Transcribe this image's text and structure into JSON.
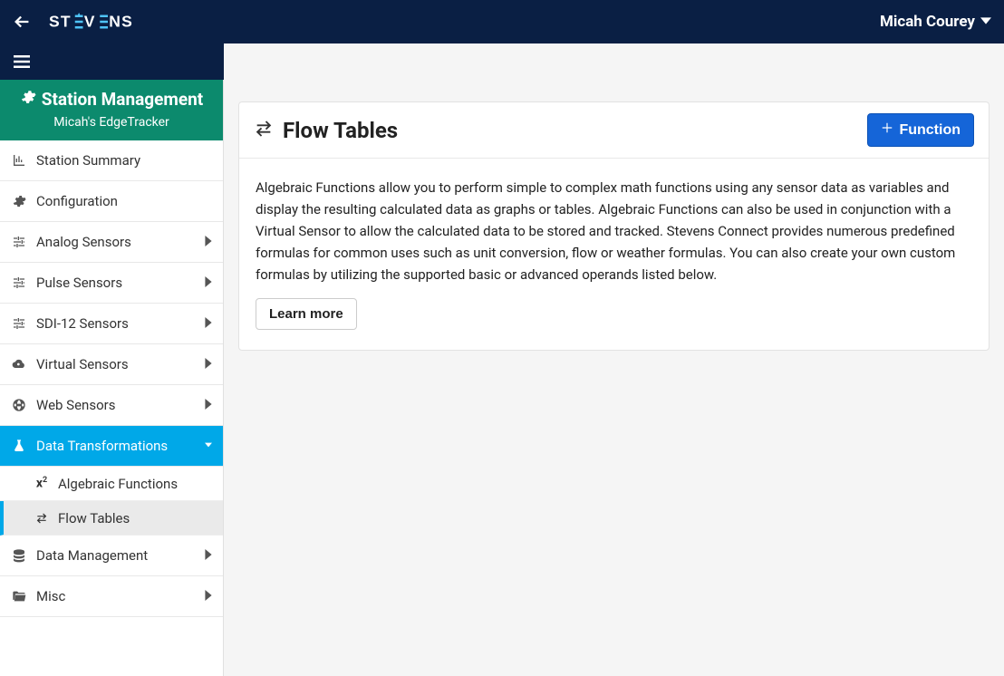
{
  "header": {
    "user_name": "Micah Courey",
    "logo_text": "STEVENS"
  },
  "sidebar": {
    "section_title": "Station Management",
    "section_subtitle": "Micah's EdgeTracker",
    "items": [
      {
        "label": "Station Summary",
        "expandable": false
      },
      {
        "label": "Configuration",
        "expandable": false
      },
      {
        "label": "Analog Sensors",
        "expandable": true
      },
      {
        "label": "Pulse Sensors",
        "expandable": true
      },
      {
        "label": "SDI-12 Sensors",
        "expandable": true
      },
      {
        "label": "Virtual Sensors",
        "expandable": true
      },
      {
        "label": "Web Sensors",
        "expandable": true
      },
      {
        "label": "Data Transformations",
        "expandable": true,
        "active": true
      },
      {
        "label": "Data Management",
        "expandable": true
      },
      {
        "label": "Misc",
        "expandable": true
      }
    ],
    "sub_items": [
      {
        "label": "Algebraic Functions",
        "selected": false
      },
      {
        "label": "Flow Tables",
        "selected": true
      }
    ]
  },
  "main": {
    "panel_title": "Flow Tables",
    "add_button_label": "Function",
    "description": "Algebraic Functions allow you to perform simple to complex math functions using any sensor data as variables and display the resulting calculated data as graphs or tables. Algebraic Functions can also be used in conjunction with a Virtual Sensor to allow the calculated data to be stored and tracked. Stevens Connect provides numerous predefined formulas for common uses such as unit conversion, flow or weather formulas. You can also create your own custom formulas by utilizing the supported basic or advanced operands listed below.",
    "learn_more_label": "Learn more"
  }
}
